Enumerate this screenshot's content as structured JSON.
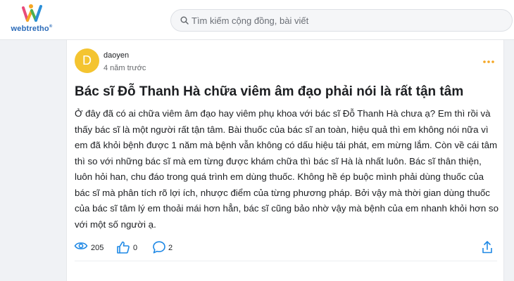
{
  "header": {
    "logo_text": "webtretho",
    "logo_reg": "®",
    "search_placeholder": "Tìm kiếm cộng đồng, bài viết"
  },
  "post": {
    "avatar_letter": "D",
    "author": "daoyen",
    "time": "4 năm trước",
    "title": "Bác sĩ Đỗ Thanh Hà chữa viêm âm đạo phải nói là rất tận tâm",
    "body": "Ở đây đã có ai chữa viêm âm đạo hay viêm phụ khoa với bác sĩ Đỗ Thanh Hà chưa ạ? Em thì rồi và thấy bác sĩ là một người rất tận tâm. Bài thuốc của bác sĩ an toàn, hiệu quả thì em không nói nữa vì em đã khỏi bệnh được 1 năm mà bệnh vẫn không có dấu hiệu tái phát, em mừng lắm. Còn về cái tâm thì so với những bác sĩ mà em từng được khám chữa thì bác sĩ Hà là nhất luôn. Bác sĩ thân thiện, luôn hỏi han, chu đáo trong quá trình em dùng thuốc. Không hề ép buộc mình phải dùng thuốc của bác sĩ mà phân tích rõ lợi ích, nhược điểm của từng phương pháp. Bởi vậy mà thời gian dùng thuốc của bác sĩ tâm lý em thoải mái hơn hẳn, bác sĩ cũng bảo nhờ vậy mà bệnh của em nhanh khỏi hơn so với một số người ạ.",
    "views": "205",
    "likes": "0",
    "comments": "2"
  },
  "colors": {
    "avatar_bg": "#f4c430",
    "accent_blue": "#1e88e5",
    "more_orange": "#f5a623",
    "logo_blue": "#2a6ab8"
  },
  "icons": {
    "logo": "webtretho-logo-icon",
    "search": "search-icon",
    "more": "more-dots-icon",
    "views": "eye-icon",
    "like": "thumbs-up-icon",
    "comment": "comment-bubble-icon",
    "share": "share-icon"
  }
}
